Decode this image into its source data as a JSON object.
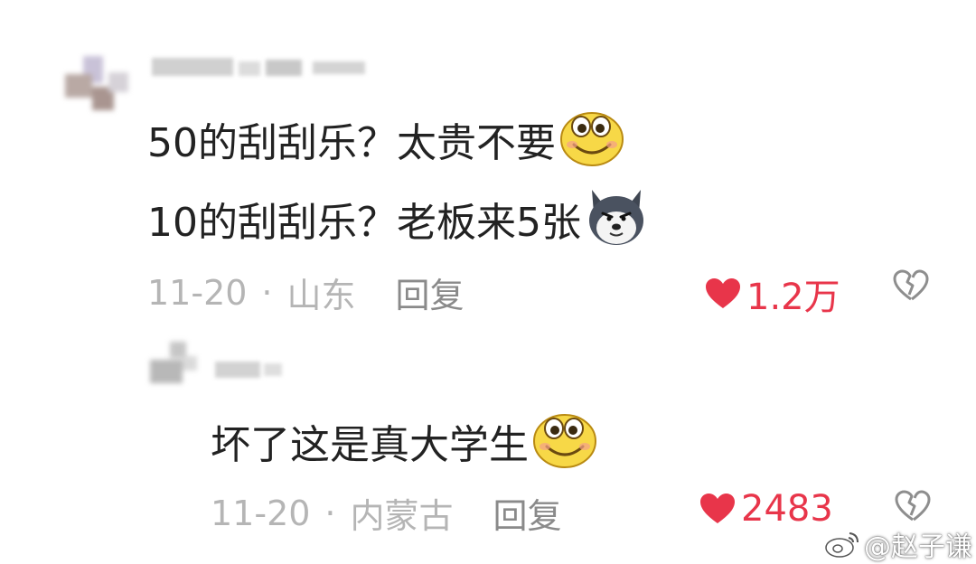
{
  "comment": {
    "line1": "50的刮刮乐？太贵不要",
    "line2": "10的刮刮乐？老板来5张",
    "date": "11-20",
    "location": "山东",
    "reply_label": "回复",
    "likes": "1.2万"
  },
  "reply": {
    "text": "坏了这是真大学生",
    "date": "11-20",
    "location": "内蒙古",
    "reply_label": "回复",
    "likes": "2483"
  },
  "separator": "·",
  "watermark": "@赵子谦",
  "icons": {
    "like": "heart-filled-icon",
    "dislike": "broken-heart-icon",
    "emoji_grin": "smiling-face-emoji-icon",
    "emoji_husky": "husky-dog-emoji-icon"
  },
  "colors": {
    "like_red": "#e8354a",
    "meta_gray": "#b5b5b5",
    "text_dark": "#222222"
  }
}
